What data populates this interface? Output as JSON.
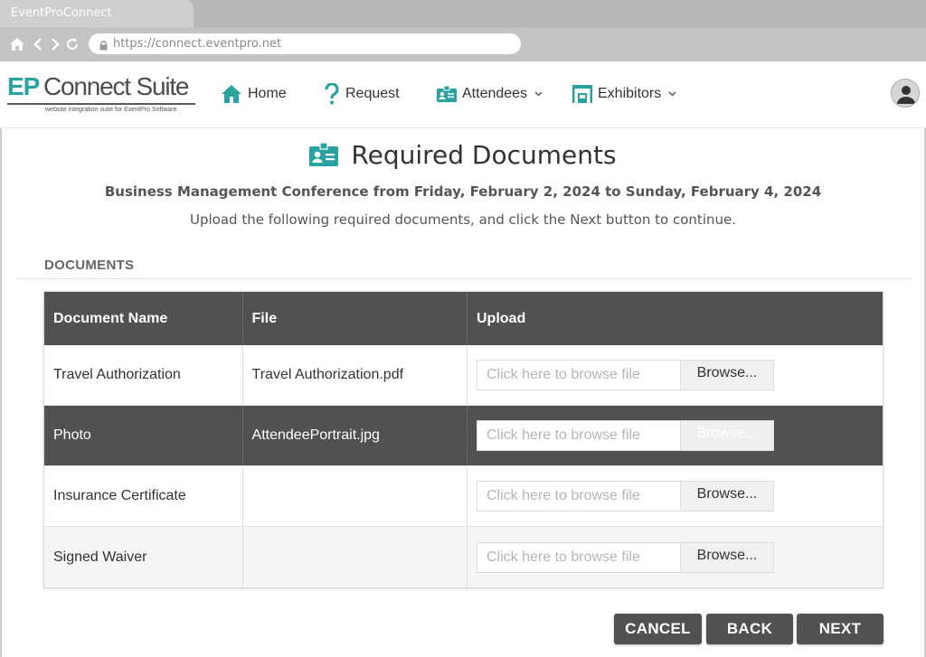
{
  "browser": {
    "tab_title": "EventProConnect",
    "url": "https://connect.eventpro.net"
  },
  "logo": {
    "ep": "EP",
    "rest": "Connect Suite",
    "sub": "website integration suite for EventPro Software"
  },
  "nav": {
    "home": "Home",
    "request": "Request",
    "attendees": "Attendees",
    "exhibitors": "Exhibitors"
  },
  "page": {
    "title": "Required Documents",
    "event_line": "Business Management Conference from Friday, February 2, 2024 to Sunday, February 4, 2024",
    "instructions": "Upload the following required documents, and click the Next button to continue.",
    "section_label": "DOCUMENTS"
  },
  "table": {
    "headers": [
      "Document Name",
      "File",
      "Upload"
    ],
    "upload_placeholder": "Click here to browse file",
    "browse_label": "Browse...",
    "rows": [
      {
        "name": "Travel Authorization",
        "file": "Travel Authorization.pdf"
      },
      {
        "name": "Photo",
        "file": "AttendeePortrait.jpg"
      },
      {
        "name": "Insurance Certificate",
        "file": ""
      },
      {
        "name": "Signed Waiver",
        "file": ""
      }
    ]
  },
  "actions": {
    "cancel": "CANCEL",
    "back": "BACK",
    "next": "NEXT"
  },
  "colors": {
    "accent": "#2aa3a0",
    "header_dark": "#515151"
  }
}
